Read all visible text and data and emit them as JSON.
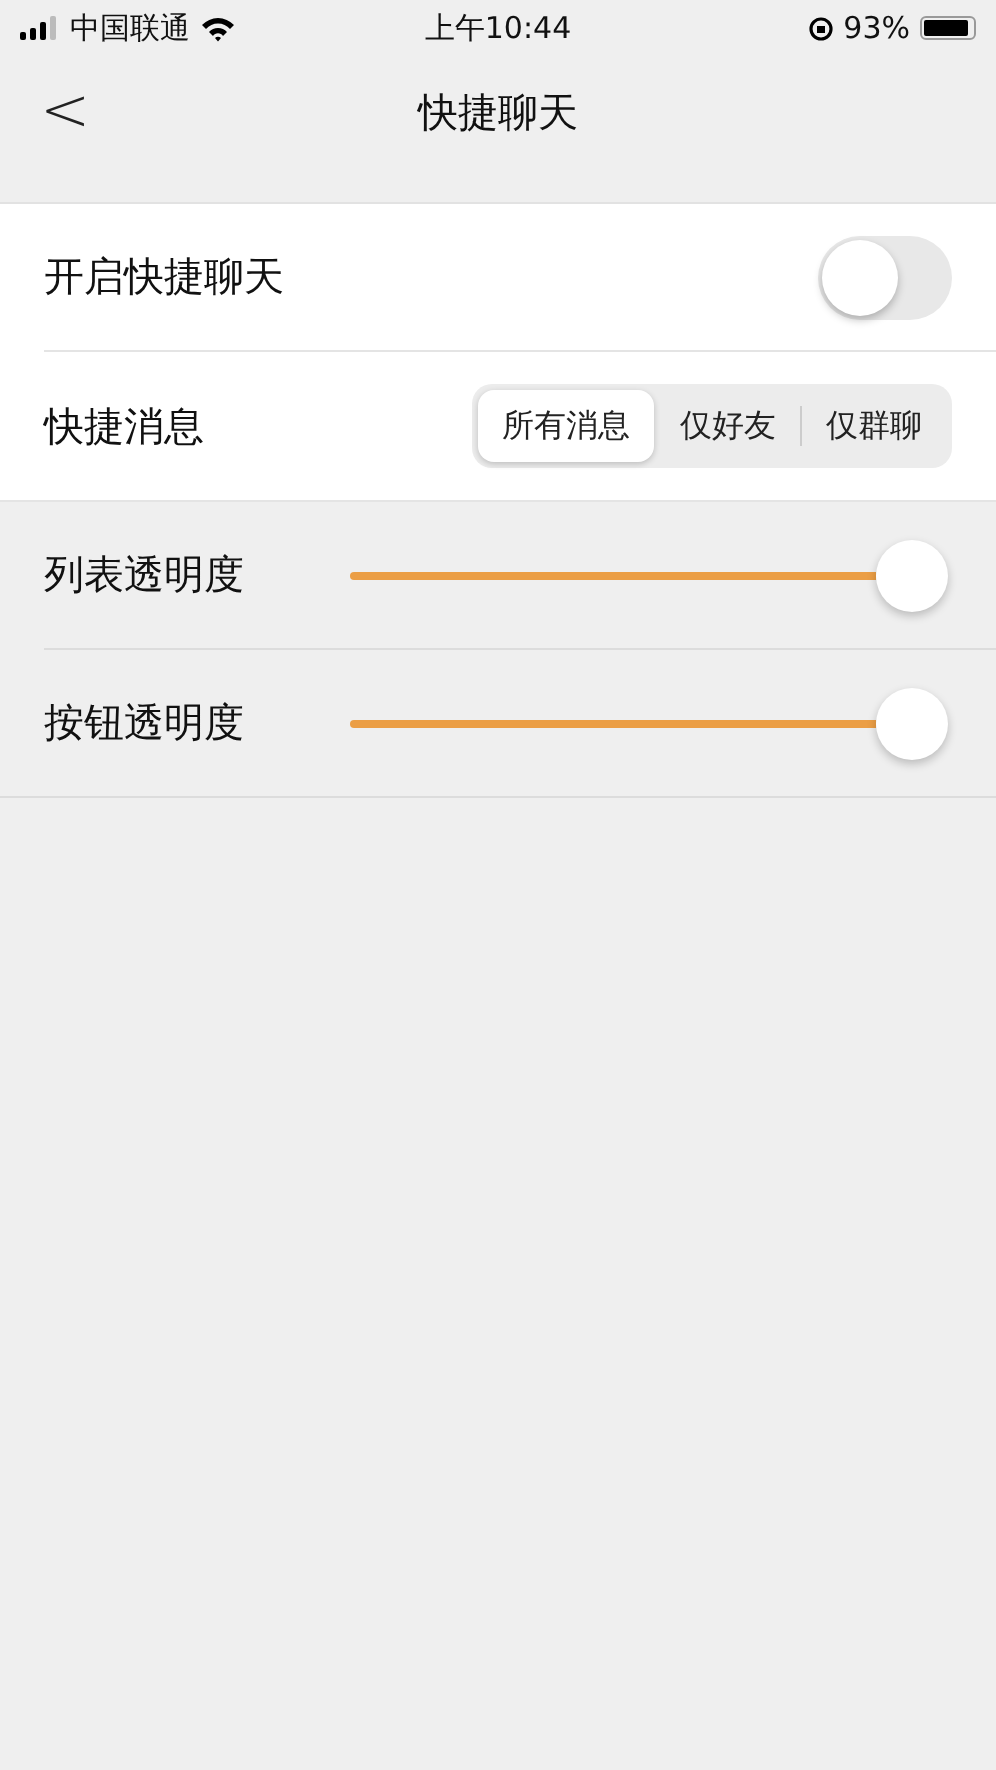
{
  "status_bar": {
    "carrier": "中国联通",
    "time": "上午10:44",
    "battery": "93%"
  },
  "nav": {
    "back": "<",
    "title": "快捷聊天"
  },
  "settings": [
    {
      "kind": "toggle",
      "label": "开启快捷聊天",
      "on": false
    },
    {
      "kind": "segmented",
      "label": "快捷消息",
      "options": [
        {
          "label": "所有消息",
          "selected": true
        },
        {
          "label": "仅好友",
          "selected": false
        },
        {
          "label": "仅群聊",
          "selected": false
        }
      ]
    }
  ],
  "sliders": [
    {
      "label": "列表透明度",
      "level": 1
    },
    {
      "label": "按钮透明度",
      "level": 1
    }
  ]
}
